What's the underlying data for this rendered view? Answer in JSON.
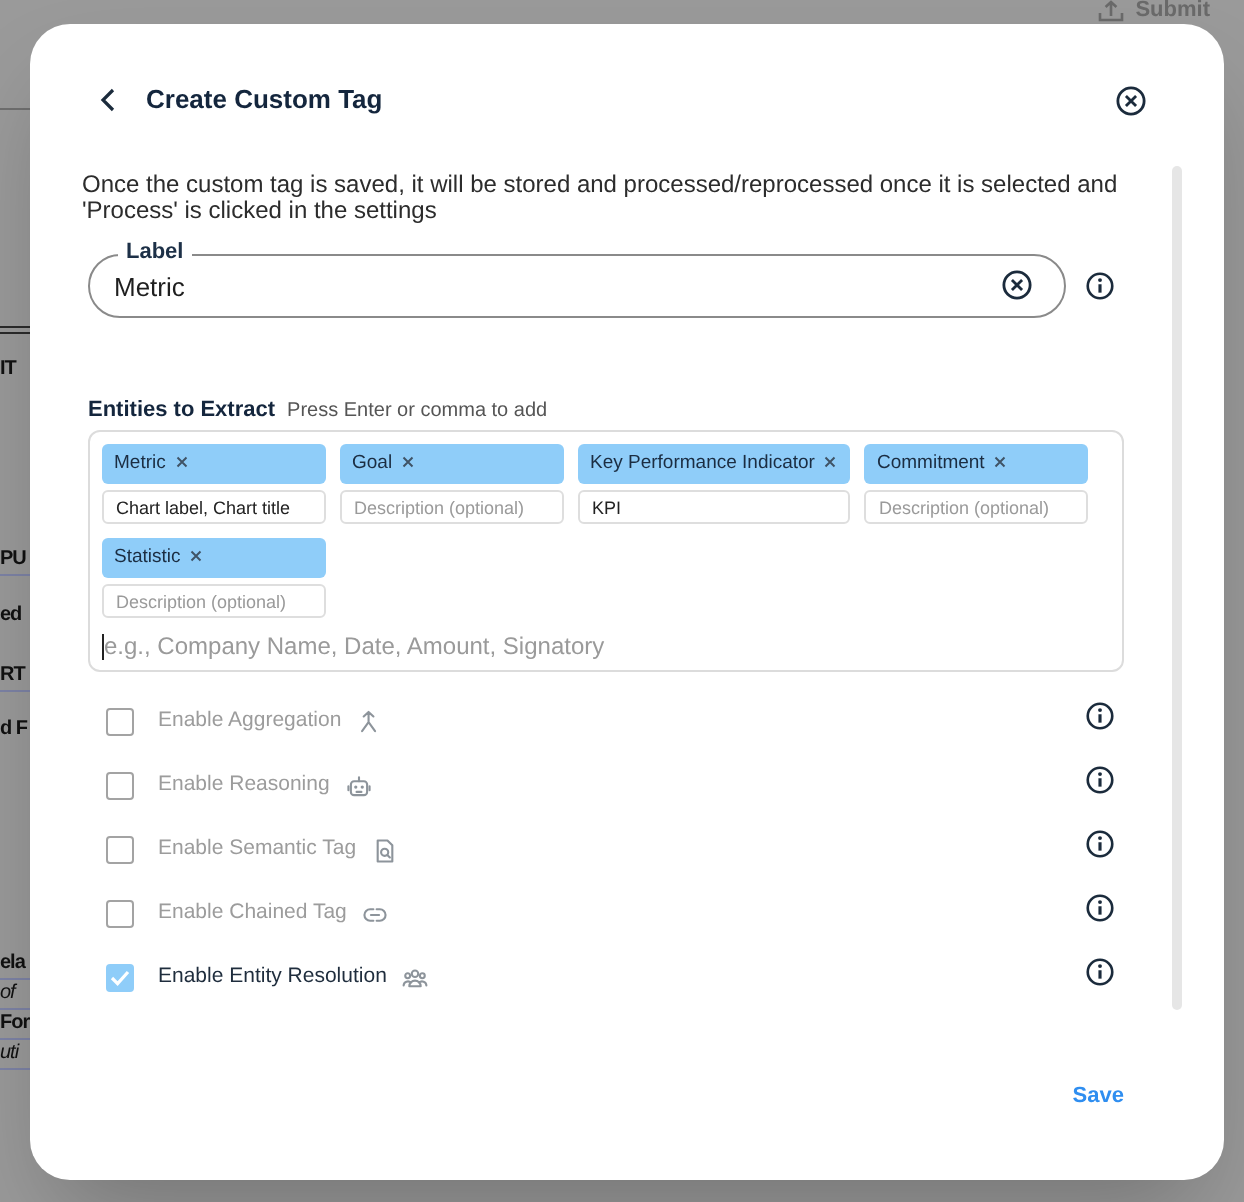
{
  "background_page": {
    "submit_button": {
      "label": "Submit"
    },
    "text_fragments": [
      {
        "text": "IT",
        "kind": "strong"
      },
      {
        "text": "PU",
        "kind": "strong"
      },
      {
        "text": "ed",
        "kind": "strong"
      },
      {
        "text": "RT",
        "kind": "strong"
      },
      {
        "text": "d F",
        "kind": "strong"
      },
      {
        "text": "ela",
        "kind": "strong"
      },
      {
        "text": "of",
        "kind": "emphasis"
      },
      {
        "text": "For",
        "kind": "strong"
      },
      {
        "text": "uti",
        "kind": "emphasis"
      }
    ]
  },
  "dialog": {
    "title": "Create Custom Tag",
    "description": "Once the custom tag is saved, it will be stored and processed/reprocessed once it is selected and 'Process' is clicked in the settings",
    "label_field": {
      "label": "Label",
      "value": "Metric"
    },
    "entities": {
      "title": "Entities to Extract",
      "hint": "Press Enter or comma to add",
      "items": [
        {
          "name": "Metric",
          "description": "Chart label, Chart title"
        },
        {
          "name": "Goal",
          "description_placeholder": "Description (optional)"
        },
        {
          "name": "Key Performance Indicator",
          "description": "KPI"
        },
        {
          "name": "Commitment",
          "description_placeholder": "Description (optional)"
        },
        {
          "name": "Statistic",
          "description_placeholder": "Description (optional)"
        }
      ],
      "input": {
        "placeholder": "e.g., Company Name, Date, Amount, Signatory"
      }
    },
    "options": [
      {
        "label": "Enable Aggregation",
        "checked": false
      },
      {
        "label": "Enable Reasoning",
        "checked": false
      },
      {
        "label": "Enable Semantic Tag",
        "checked": false
      },
      {
        "label": "Enable Chained Tag",
        "checked": false
      },
      {
        "label": "Enable Entity Resolution",
        "checked": true
      }
    ],
    "save_button": {
      "label": "Save"
    }
  }
}
